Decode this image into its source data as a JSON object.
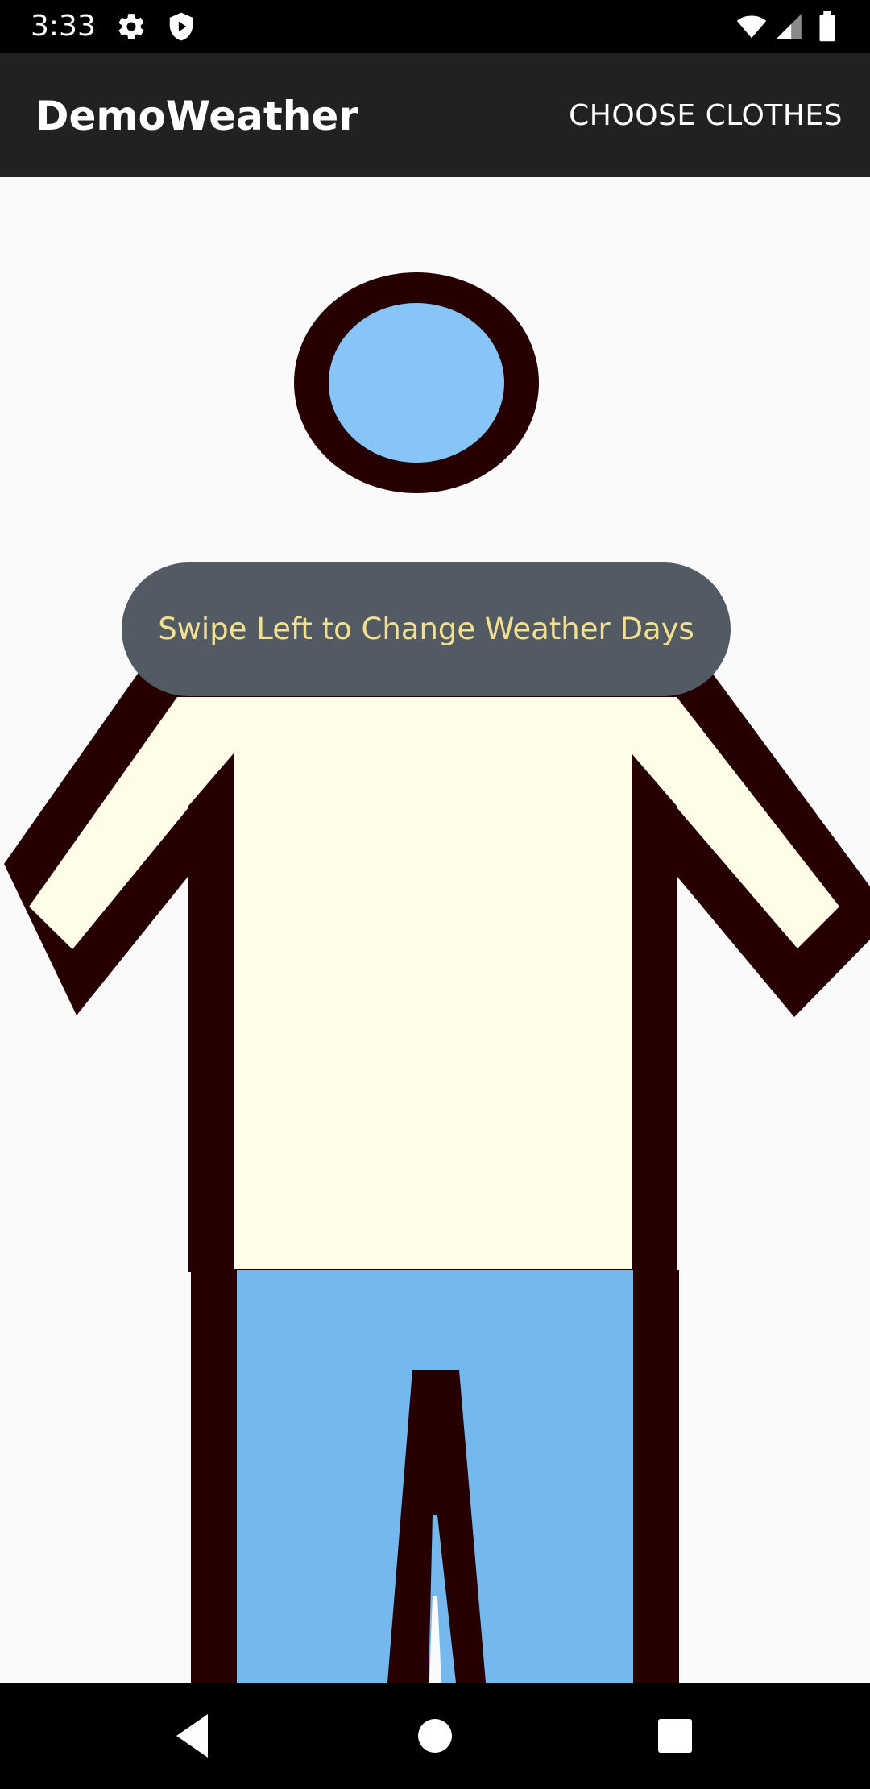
{
  "status_bar": {
    "time": "3:33",
    "icons": [
      "gear-icon",
      "shield-play-icon",
      "wifi-icon",
      "signal-icon",
      "battery-icon"
    ]
  },
  "app_bar": {
    "title": "DemoWeather",
    "action_label": "CHOOSE CLOTHES"
  },
  "content": {
    "toast_text": "Swipe Left to Change Weather Days",
    "figure": {
      "outline_color": "#260000",
      "head_color": "#87c4f7",
      "shirt_color": "#fffde7",
      "pants_color": "#74b8ee"
    }
  },
  "navigation": {
    "icons": [
      "back-icon",
      "home-icon",
      "recents-icon"
    ]
  },
  "colors": {
    "status_bar_bg": "#000000",
    "app_bar_bg": "#212121",
    "background": "#fafafa",
    "toast_bg": "#525a63",
    "toast_text": "#f3e08f"
  }
}
